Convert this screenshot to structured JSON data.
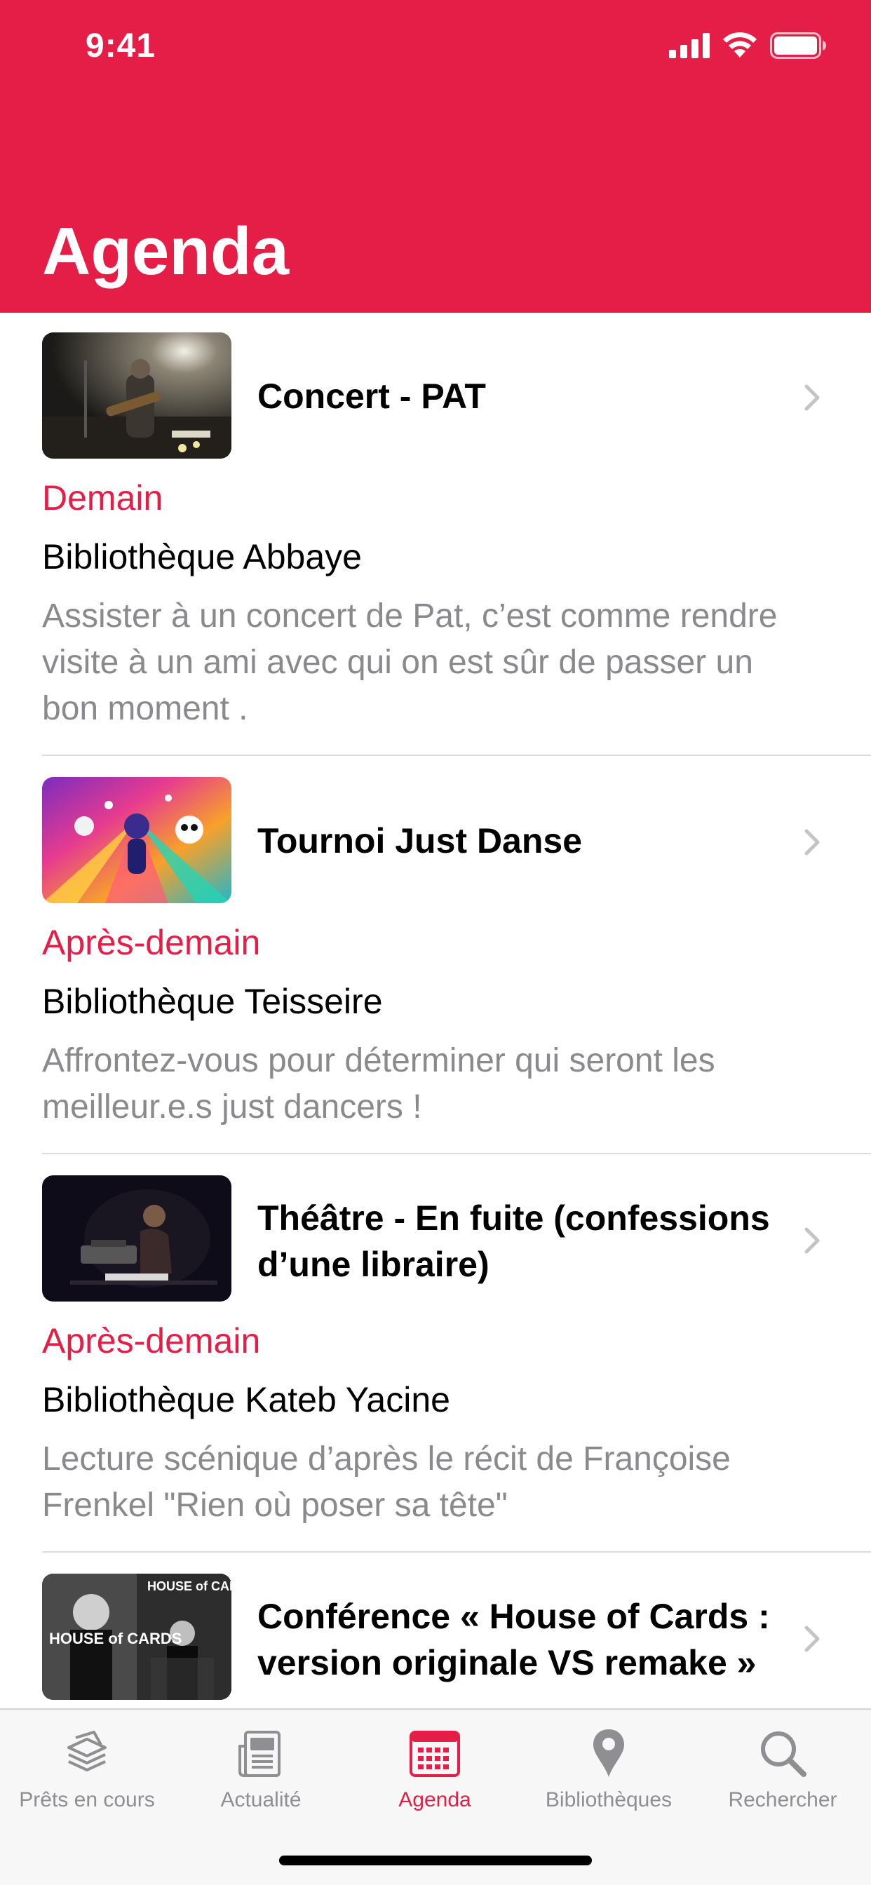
{
  "status_bar": {
    "time": "9:41"
  },
  "header": {
    "title": "Agenda",
    "color": "#e51e48"
  },
  "events": [
    {
      "title": "Concert - PAT",
      "when": "Demain",
      "place": "Bibliothèque Abbaye",
      "description": "Assister à un concert de Pat, c’est comme rendre visite à un ami avec qui on est sûr de passer un bon moment ."
    },
    {
      "title": "Tournoi Just Danse",
      "when": "Après-demain",
      "place": "Bibliothèque Teisseire",
      "description": "Affrontez-vous pour déterminer qui seront les meilleur.e.s just dancers !"
    },
    {
      "title": "Théâtre - En fuite (confessions d’une libraire)",
      "when": "Après-demain",
      "place": "Bibliothèque Kateb Yacine",
      "description": "Lecture scénique d’après le récit de Françoise Frenkel \"Rien où poser sa tête\""
    },
    {
      "title": "Conférence « House of Cards : version originale VS remake »",
      "thumb_text": {
        "top": "HOUSE of CARDS",
        "bottom": "HOUSE of CARDS"
      }
    }
  ],
  "tabbar": {
    "tabs": [
      {
        "label": "Prêts en cours",
        "icon": "stack-icon"
      },
      {
        "label": "Actualité",
        "icon": "newspaper-icon"
      },
      {
        "label": "Agenda",
        "icon": "calendar-icon",
        "active": true
      },
      {
        "label": "Bibliothèques",
        "icon": "map-pin-icon"
      },
      {
        "label": "Rechercher",
        "icon": "search-icon"
      }
    ],
    "active_color": "#e51e48",
    "inactive_color": "#8e8e93"
  }
}
